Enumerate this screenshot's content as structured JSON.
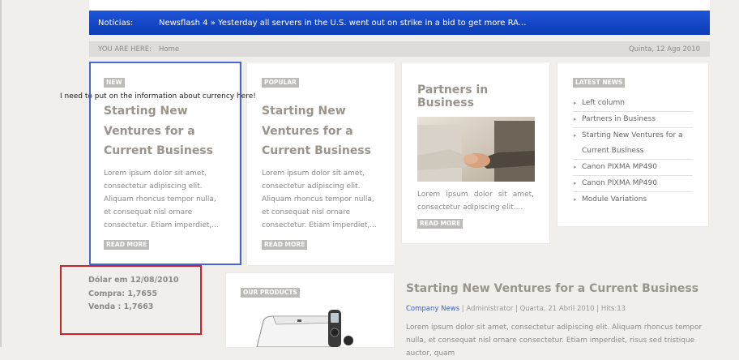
{
  "newsflash": {
    "label": "Notícias:",
    "text": "Newsflash 4 » Yesterday all servers in the U.S. went out on strike in a bid to get more RA..."
  },
  "breadcrumb": {
    "you_are_here": "YOU ARE HERE:",
    "home": "Home",
    "date": "Quinta, 12 Ago 2010"
  },
  "overlay_note": "I need to put on the information about currency here!",
  "cards": [
    {
      "badge": "NEW",
      "title": "Starting New Ventures for a Current Business",
      "text": "Lorem ipsum dolor sit amet, consectetur adipiscing elit. Aliquam rhoncus tempor nulla, et consequat nisl ornare consectetur. Etiam imperdiet,...",
      "readmore": "READ MORE"
    },
    {
      "badge": "POPULAR",
      "title": "Starting New Ventures for a Current Business",
      "text": "Lorem ipsum dolor sit amet, consectetur adipiscing elit. Aliquam rhoncus tempor nulla, et consequat nisl ornare consectetur. Etiam imperdiet,...",
      "readmore": "READ MORE"
    }
  ],
  "partners": {
    "title": "Partners in Business",
    "text": "Lorem ipsum dolor sit amet, consectetur adipiscing elit....",
    "readmore": "READ MORE"
  },
  "latest_news": {
    "badge": "LATEST NEWS",
    "items": [
      "Left column",
      "Partners in Business",
      "Starting New Ventures for a Current Business",
      "Canon PIXMA MP490",
      "Canon PIXMA MP490",
      "Module Variations"
    ]
  },
  "currency": {
    "line1": "Dólar em 12/08/2010",
    "line2": "Compra: 1,7655",
    "line3": "Venda : 1,7663"
  },
  "products": {
    "badge": "OUR PRODUCTS"
  },
  "article": {
    "title": "Starting New Ventures for a Current Business",
    "category": "Company News",
    "meta_rest": " | Administrator | Quarta, 21 Abril 2010 | Hits:13",
    "body": "Lorem ipsum dolor sit amet, consectetur adipiscing elit. Aliquam rhoncus tempor nulla, et consequat nisl ornare consectetur. Etiam imperdiet, risus sed tristique auctor, quam"
  },
  "colors": {
    "accent_blue": "#1e54d8",
    "highlight_blue": "#4965d3",
    "highlight_red": "#d0212a"
  }
}
